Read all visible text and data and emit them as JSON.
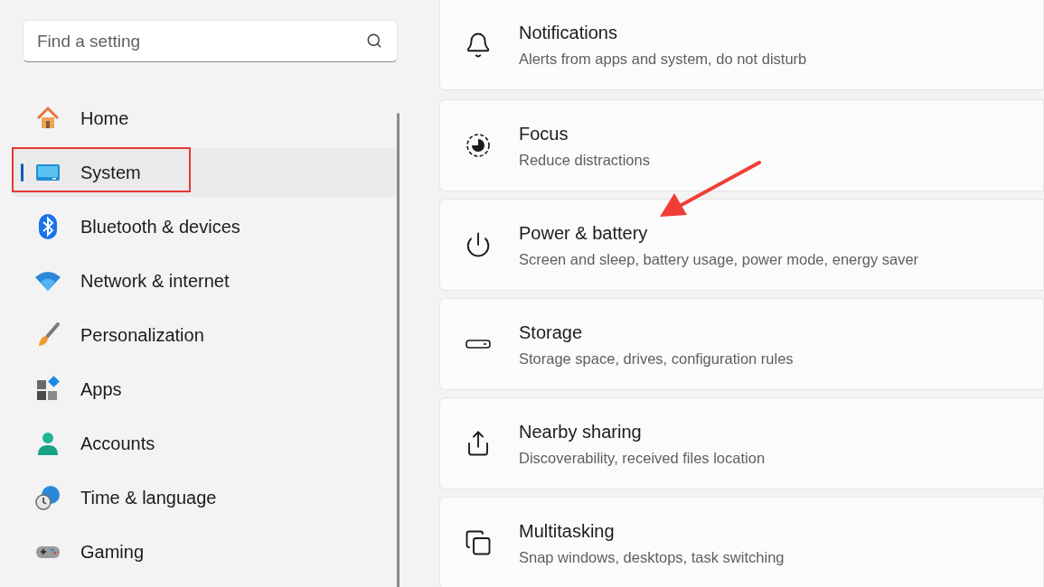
{
  "search": {
    "placeholder": "Find a setting"
  },
  "nav": [
    {
      "label": "Home",
      "kind": "home",
      "selected": false
    },
    {
      "label": "System",
      "kind": "system",
      "selected": true
    },
    {
      "label": "Bluetooth & devices",
      "kind": "bluetooth",
      "selected": false
    },
    {
      "label": "Network & internet",
      "kind": "network",
      "selected": false
    },
    {
      "label": "Personalization",
      "kind": "brush",
      "selected": false
    },
    {
      "label": "Apps",
      "kind": "apps",
      "selected": false
    },
    {
      "label": "Accounts",
      "kind": "accounts",
      "selected": false
    },
    {
      "label": "Time & language",
      "kind": "time",
      "selected": false
    },
    {
      "label": "Gaming",
      "kind": "gaming",
      "selected": false
    }
  ],
  "settings": [
    {
      "title": "Notifications",
      "subtitle": "Alerts from apps and system, do not disturb",
      "kind": "bell"
    },
    {
      "title": "Focus",
      "subtitle": "Reduce distractions",
      "kind": "focus"
    },
    {
      "title": "Power & battery",
      "subtitle": "Screen and sleep, battery usage, power mode, energy saver",
      "kind": "power"
    },
    {
      "title": "Storage",
      "subtitle": "Storage space, drives, configuration rules",
      "kind": "storage"
    },
    {
      "title": "Nearby sharing",
      "subtitle": "Discoverability, received files location",
      "kind": "share"
    },
    {
      "title": "Multitasking",
      "subtitle": "Snap windows, desktops, task switching",
      "kind": "multitask"
    }
  ]
}
